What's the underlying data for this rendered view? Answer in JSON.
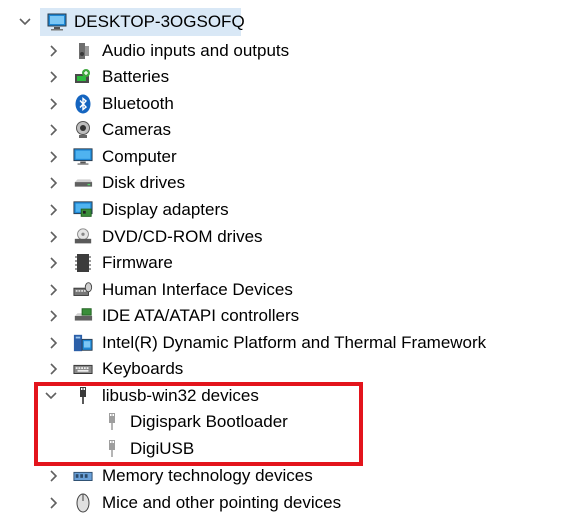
{
  "tree": {
    "root": {
      "label": "DESKTOP-3OGSOFQ",
      "expanded": true,
      "icon": "computer-icon"
    },
    "categories": [
      {
        "label": "Audio inputs and outputs",
        "icon": "speaker-icon",
        "expanded": false
      },
      {
        "label": "Batteries",
        "icon": "battery-icon",
        "expanded": false
      },
      {
        "label": "Bluetooth",
        "icon": "bluetooth-icon",
        "expanded": false
      },
      {
        "label": "Cameras",
        "icon": "camera-icon",
        "expanded": false
      },
      {
        "label": "Computer",
        "icon": "monitor-icon",
        "expanded": false
      },
      {
        "label": "Disk drives",
        "icon": "disk-drive-icon",
        "expanded": false
      },
      {
        "label": "Display adapters",
        "icon": "display-adapter-icon",
        "expanded": false
      },
      {
        "label": "DVD/CD-ROM drives",
        "icon": "dvd-drive-icon",
        "expanded": false
      },
      {
        "label": "Firmware",
        "icon": "firmware-chip-icon",
        "expanded": false
      },
      {
        "label": "Human Interface Devices",
        "icon": "hid-icon",
        "expanded": false
      },
      {
        "label": "IDE ATA/ATAPI controllers",
        "icon": "ide-controller-icon",
        "expanded": false
      },
      {
        "label": "Intel(R) Dynamic Platform and Thermal Framework",
        "icon": "intel-platform-icon",
        "expanded": false
      },
      {
        "label": "Keyboards",
        "icon": "keyboard-icon",
        "expanded": false
      },
      {
        "label": "libusb-win32 devices",
        "icon": "usb-plug-icon",
        "expanded": true,
        "children": [
          {
            "label": "Digispark Bootloader",
            "icon": "usb-device-icon"
          },
          {
            "label": "DigiUSB",
            "icon": "usb-device-icon"
          }
        ]
      },
      {
        "label": "Memory technology devices",
        "icon": "memory-icon",
        "expanded": false
      },
      {
        "label": "Mice and other pointing devices",
        "icon": "mouse-icon",
        "expanded": false
      }
    ]
  },
  "colors": {
    "selection": "#d9e8f6",
    "highlight_border": "#e3141c",
    "chevron": "#606060"
  }
}
